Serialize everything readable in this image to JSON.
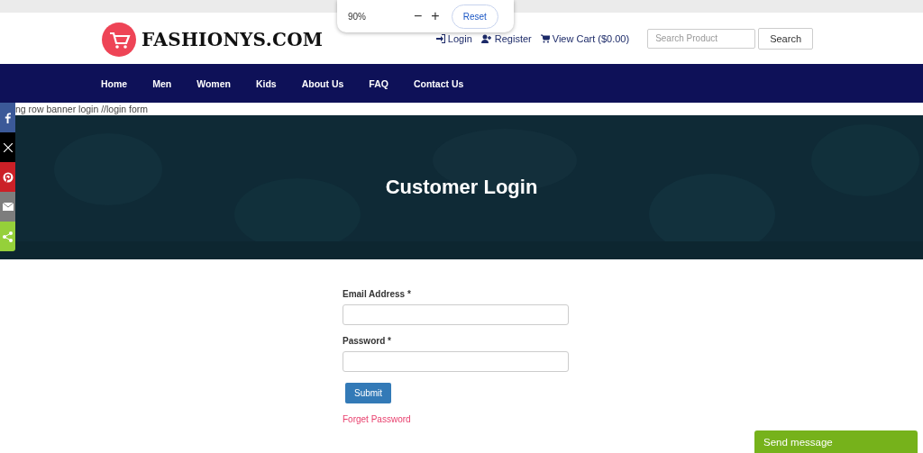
{
  "zoom_popup": {
    "level": "90%",
    "zoom_out": "−",
    "zoom_in": "+",
    "reset": "Reset"
  },
  "header": {
    "logo": "FASHIONYS.COM",
    "links": [
      {
        "kind": "login",
        "label": "Login"
      },
      {
        "kind": "register",
        "label": "Register"
      },
      {
        "kind": "cart",
        "label": "View Cart ($0.00)"
      }
    ],
    "search": {
      "placeholder": "Search Product",
      "button": "Search"
    }
  },
  "nav": [
    "Home",
    "Men",
    "Women",
    "Kids",
    "About Us",
    "FAQ",
    "Contact Us"
  ],
  "debug_text": "ng row banner login //login form",
  "social": [
    {
      "kind": "facebook",
      "color": "#3b5998"
    },
    {
      "kind": "x",
      "color": "#000000"
    },
    {
      "kind": "pinterest",
      "color": "#cb2027"
    },
    {
      "kind": "email",
      "color": "#7d7d7d"
    },
    {
      "kind": "share",
      "color": "#95d03a"
    }
  ],
  "banner": {
    "title": "Customer Login"
  },
  "form": {
    "fields": [
      {
        "label": "Email Address *"
      },
      {
        "label": "Password *"
      }
    ],
    "submit": "Submit",
    "forgot": "Forget Password"
  },
  "chat": {
    "label": "Send message"
  }
}
